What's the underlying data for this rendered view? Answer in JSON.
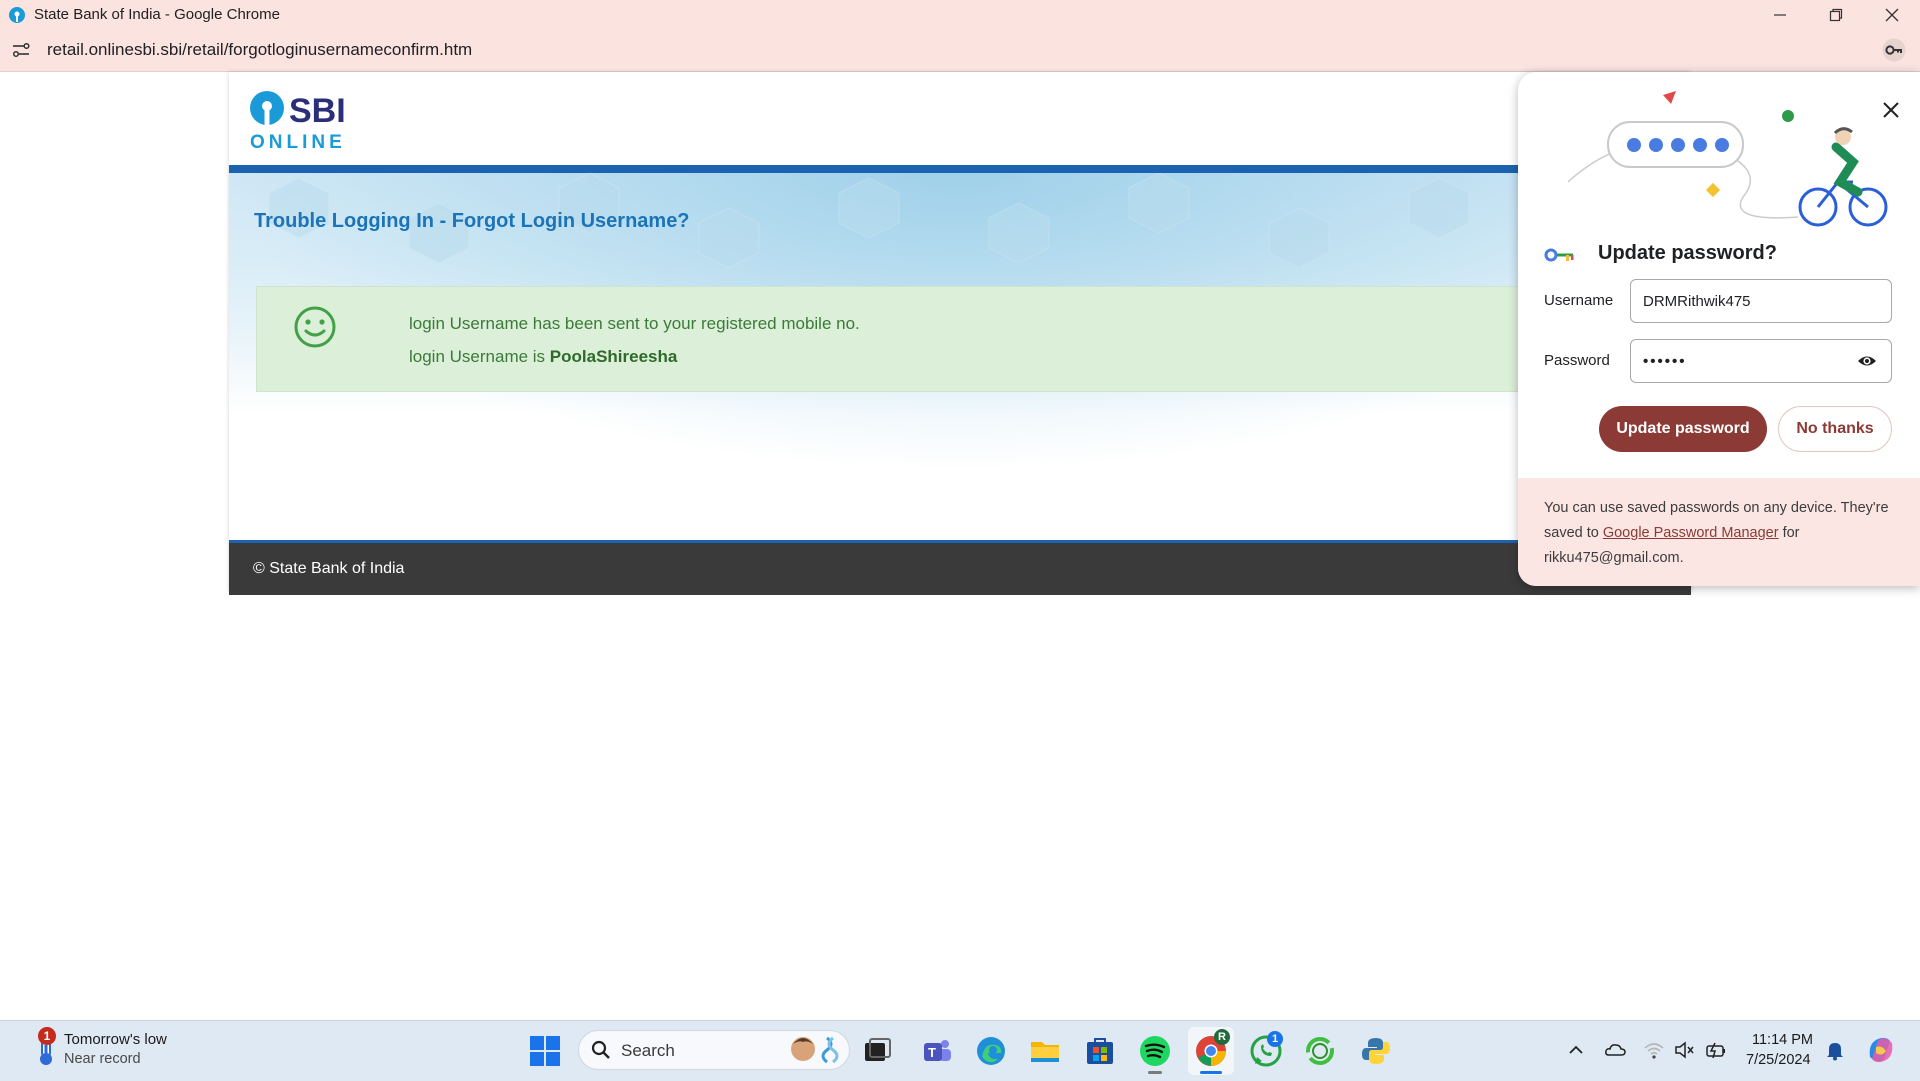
{
  "window": {
    "title": "State Bank of India - Google Chrome"
  },
  "addressbar": {
    "url": "retail.onlinesbi.sbi/retail/forgotloginusernameconfirm.htm"
  },
  "page": {
    "logo_text_top": "SBI",
    "logo_text_bottom": "ONLINE",
    "heading": "Trouble Logging In - Forgot Login Username?",
    "message_line1": "login Username has been sent to your registered mobile no.",
    "message_line2_prefix": "login Username is ",
    "username_value": "PoolaShireesha",
    "footer": "© State Bank of India"
  },
  "password_popup": {
    "title": "Update password?",
    "username_label": "Username",
    "username_value": "DRMRithwik475",
    "password_label": "Password",
    "password_masked": "••••••",
    "update_button": "Update password",
    "no_thanks_button": "No thanks",
    "footer_text_1": "You can use saved passwords on any device. They're saved to ",
    "footer_link": "Google Password Manager",
    "footer_text_2": " for rikku475@gmail.com."
  },
  "taskbar": {
    "weather_title": "Tomorrow's low",
    "weather_sub": "Near record",
    "weather_badge": "1",
    "search_placeholder": "Search",
    "whatsapp_badge": "1",
    "chrome_badge": "R",
    "time": "11:14 PM",
    "date": "7/25/2024"
  },
  "colors": {
    "chrome_frame": "#fbe3e0",
    "sbi_blue": "#1b63b0",
    "success_bg": "#dcefd9",
    "success_text": "#3c7a3a",
    "popup_primary": "#8b3a35",
    "footer_dark": "#3a3a3a"
  }
}
